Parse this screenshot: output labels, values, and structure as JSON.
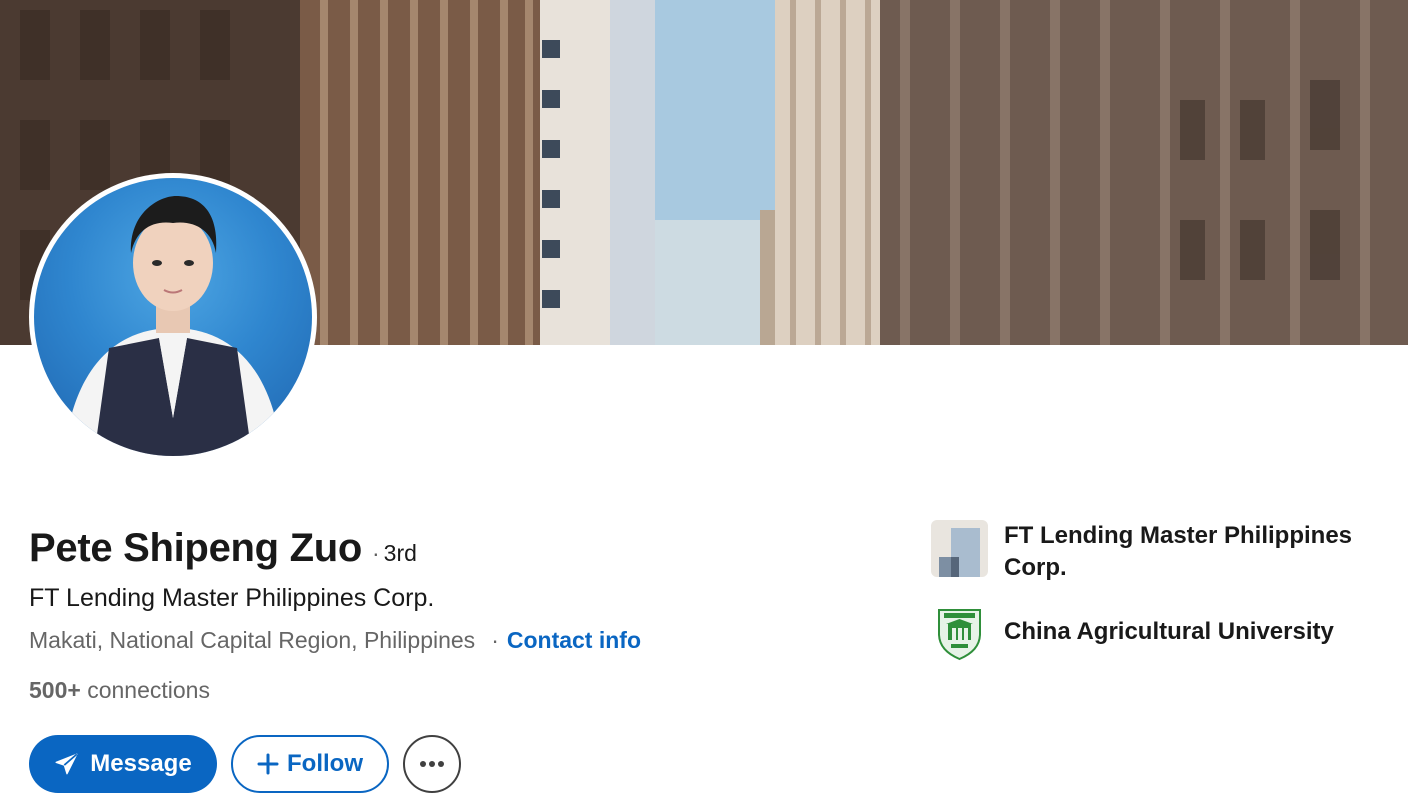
{
  "profile": {
    "name": "Pete Shipeng Zuo",
    "degree_separator": "·",
    "degree": "3rd",
    "headline": "FT Lending Master Philippines Corp.",
    "location": "Makati, National Capital Region, Philippines",
    "location_separator": "·",
    "contact_info_label": "Contact info",
    "connections_count": "500+",
    "connections_label": "connections"
  },
  "actions": {
    "message_label": "Message",
    "follow_label": "Follow",
    "more_label": "···"
  },
  "entities": [
    {
      "name": "FT Lending Master Philippines Corp.",
      "logo_icon": "company-logo-icon"
    },
    {
      "name": "China Agricultural University",
      "logo_icon": "university-crest-icon"
    }
  ],
  "colors": {
    "accent": "#0a66c2",
    "text_primary": "#191919",
    "text_secondary": "#666666"
  }
}
